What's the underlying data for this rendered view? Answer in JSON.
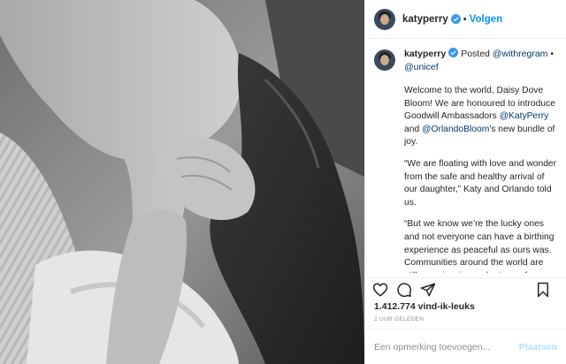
{
  "header": {
    "username": "katyperry",
    "separator": "•",
    "follow_label": "Volgen"
  },
  "caption": {
    "username": "katyperry",
    "posted_label": "Posted",
    "mention_withregram": "@withregram",
    "separator": "•",
    "mention_unicef": "@unicef",
    "p1_a": "Welcome to the world, Daisy Dove Bloom! We are honoured to introduce Goodwill Ambassadors ",
    "p1_mention1": "@KatyPerry",
    "p1_b": " and ",
    "p1_mention2": "@OrlandoBloom",
    "p1_c": "'s new bundle of joy.",
    "p2": "“We are floating with love and wonder from the safe and healthy arrival of our daughter,” Katy and Orlando told us.",
    "p3": "“But we know we’re the lucky ones and not everyone can have a birthing experience as peaceful as ours was. Communities around the world are still experiencing a shortage of healthcare workers and every eleven seconds a pregnant woman or newborn dies, mostly from preventable causes. Since"
  },
  "stats": {
    "likes": "1.412.774 vind-ik-leuks",
    "time": "2 UUR GELEDEN"
  },
  "comment": {
    "placeholder": "Een opmerking toevoegen...",
    "post_label": "Plaatsen"
  },
  "colors": {
    "link": "#00376b",
    "follow": "#0095f6",
    "post_disabled": "#b2dffc",
    "verified": "#3897f0"
  },
  "icons": [
    "heart-icon",
    "comment-icon",
    "share-icon",
    "bookmark-icon",
    "verified-badge-icon"
  ]
}
